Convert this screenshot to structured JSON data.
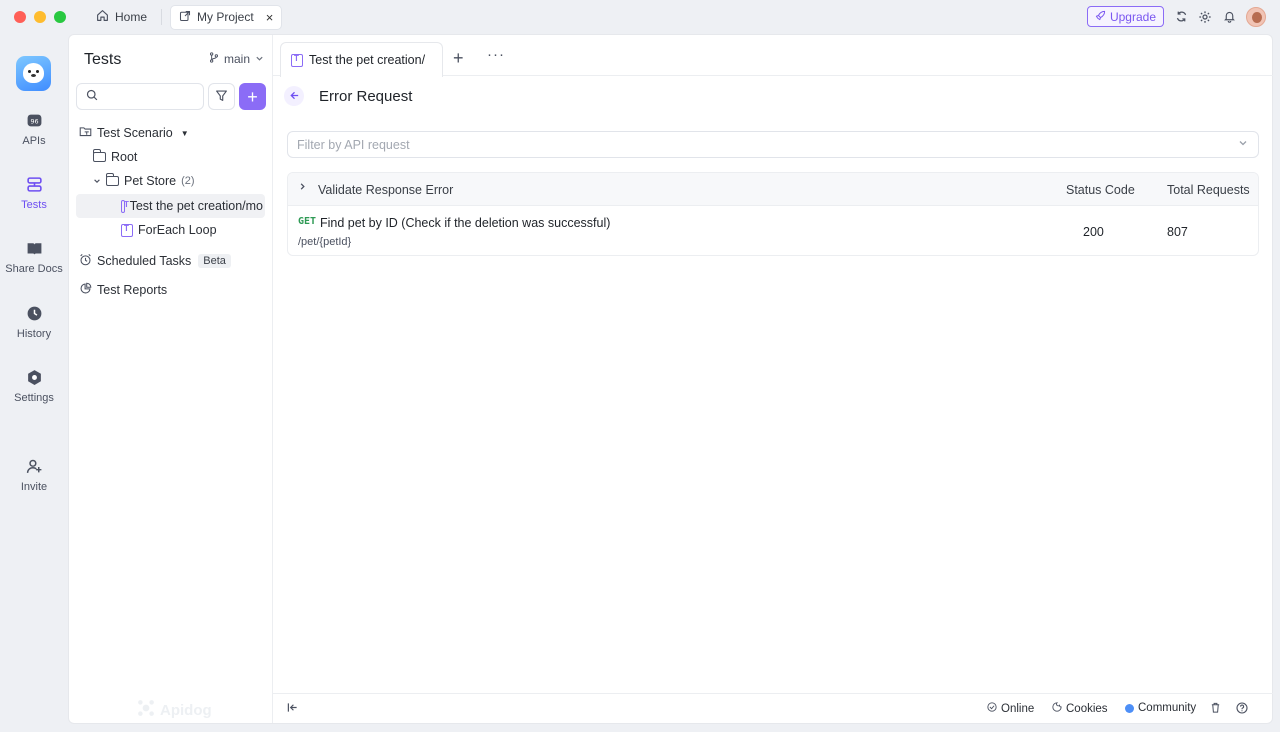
{
  "window": {
    "tabs": [
      {
        "label": "Home",
        "icon": "home-icon"
      },
      {
        "label": "My Project",
        "icon": "project-icon",
        "close": "×"
      }
    ],
    "upgrade_label": "Upgrade"
  },
  "rail": {
    "items": [
      {
        "label": "APIs",
        "icon": "api-icon"
      },
      {
        "label": "Tests",
        "icon": "tests-icon",
        "active": true
      },
      {
        "label": "Share Docs",
        "icon": "book-icon"
      },
      {
        "label": "History",
        "icon": "clock-icon"
      },
      {
        "label": "Settings",
        "icon": "gear-icon"
      },
      {
        "label": "Invite",
        "icon": "invite-icon"
      }
    ],
    "accent": "#6e4ff2"
  },
  "sidebar": {
    "title": "Tests",
    "branch": "main",
    "search_placeholder": "",
    "tree": {
      "scenario": "Test Scenario",
      "root": "Root",
      "pet_store": "Pet Store",
      "pet_store_count": "(2)",
      "test_creation": "Test the pet creation/mo",
      "foreach": "ForEach Loop",
      "scheduled": "Scheduled Tasks",
      "beta": "Beta",
      "reports": "Test Reports"
    },
    "watermark": "Apidog"
  },
  "main": {
    "tab_label": "Test the pet creation/",
    "page_title": "Error Request",
    "filter_placeholder": "Filter by API request",
    "table": {
      "group": "Validate Response Error",
      "col_status": "Status Code",
      "col_total": "Total Requests",
      "rows": [
        {
          "method": "GET",
          "name": "Find pet by ID (Check if the deletion was successful)",
          "path": "/pet/{petId}",
          "status": "200",
          "total": "807"
        }
      ]
    }
  },
  "footer": {
    "online": "Online",
    "cookies": "Cookies",
    "community": "Community"
  }
}
